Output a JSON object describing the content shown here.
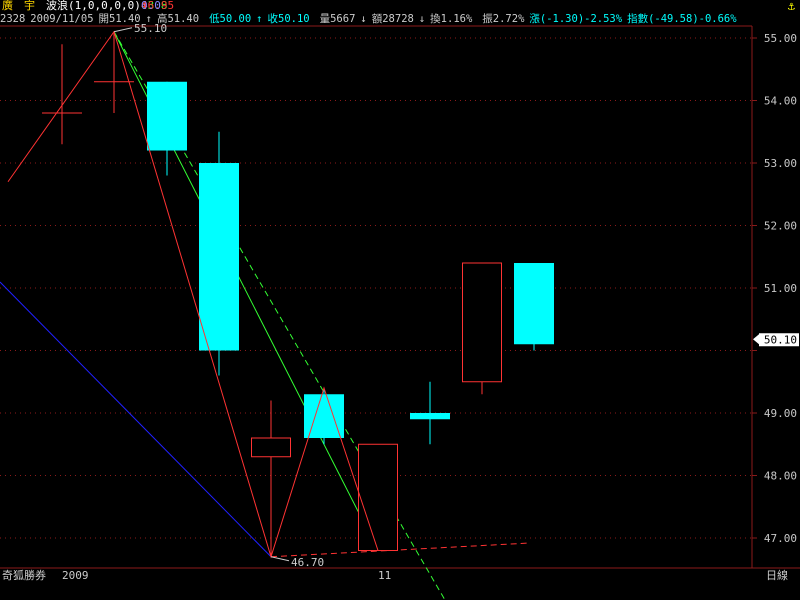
{
  "header": {
    "stock_name": "廣　宇",
    "indicator": "波浪(1,0,0,0,0)",
    "ind_v1": "43.8",
    "ind_v1_arrow": "↓",
    "ind_v2": "46.95",
    "ind_v2_arrow": "↑",
    "ind_v3": "0.0",
    "corner_icon": "anchor-icon"
  },
  "quote": {
    "code": "2328",
    "date": "2009/11/05",
    "open": "開51.40",
    "open_arrow": "↑",
    "high": "高51.40",
    "low": "低50.00",
    "low_arrow": "↑",
    "close": "收50.10",
    "close_arrow": "↓",
    "volume": "量5667",
    "volume_arrow": "↓",
    "amount": "額28728",
    "amount_arrow": "↓",
    "turnover": "換1.16%",
    "amplitude": "振2.72%",
    "change": "漲(-1.30)-2.53%",
    "index": "指數(-49.58)-0.66%"
  },
  "footer": {
    "broker": "奇狐勝券",
    "year": "2009",
    "month": "11",
    "period": "日線"
  },
  "annotations": {
    "high_label": "55.10",
    "low_label": "46.70",
    "current_price": "50.10"
  },
  "colors": {
    "up": "#ff3333",
    "down": "#00ffff",
    "background": "#000000",
    "grid": "#8b1a1a",
    "axis_text": "#c8c8c8",
    "wave": "#ff3333",
    "trend_green": "#33ff33",
    "trend_blue": "#2020ff"
  },
  "chart_data": {
    "type": "candlestick",
    "ylim": [
      46.6,
      55.35
    ],
    "yticks": [
      "55.00",
      "54.00",
      "53.00",
      "52.00",
      "51.00",
      "50.00",
      "49.00",
      "48.00",
      "47.00"
    ],
    "ytick_values": [
      55,
      54,
      53,
      52,
      51,
      50,
      49,
      48,
      47
    ],
    "candles": [
      {
        "open": 53.8,
        "close": 53.8,
        "high": 54.9,
        "low": 53.3
      },
      {
        "open": 54.3,
        "close": 54.3,
        "high": 55.1,
        "low": 53.8
      },
      {
        "open": 54.3,
        "close": 53.2,
        "high": 54.3,
        "low": 52.8
      },
      {
        "open": 53.0,
        "close": 50.0,
        "high": 53.5,
        "low": 49.6
      },
      {
        "open": 48.3,
        "close": 48.6,
        "high": 49.2,
        "low": 46.7
      },
      {
        "open": 49.3,
        "close": 48.6,
        "high": 49.4,
        "low": 48.5
      },
      {
        "open": 46.8,
        "close": 48.5,
        "high": 48.5,
        "low": 46.8
      },
      {
        "open": 49.0,
        "close": 48.9,
        "high": 49.5,
        "low": 48.5
      },
      {
        "open": 49.5,
        "close": 51.4,
        "high": 51.4,
        "low": 49.3
      },
      {
        "open": 51.4,
        "close": 50.1,
        "high": 51.4,
        "low": 50.0
      }
    ],
    "wave_points": [
      {
        "candle": -1,
        "price": 52.7
      },
      {
        "candle": 1,
        "price": 55.1
      },
      {
        "candle": 4,
        "price": 46.7
      },
      {
        "candle": 5,
        "price": 49.4
      },
      {
        "candle": 6,
        "price": 46.8
      }
    ]
  }
}
